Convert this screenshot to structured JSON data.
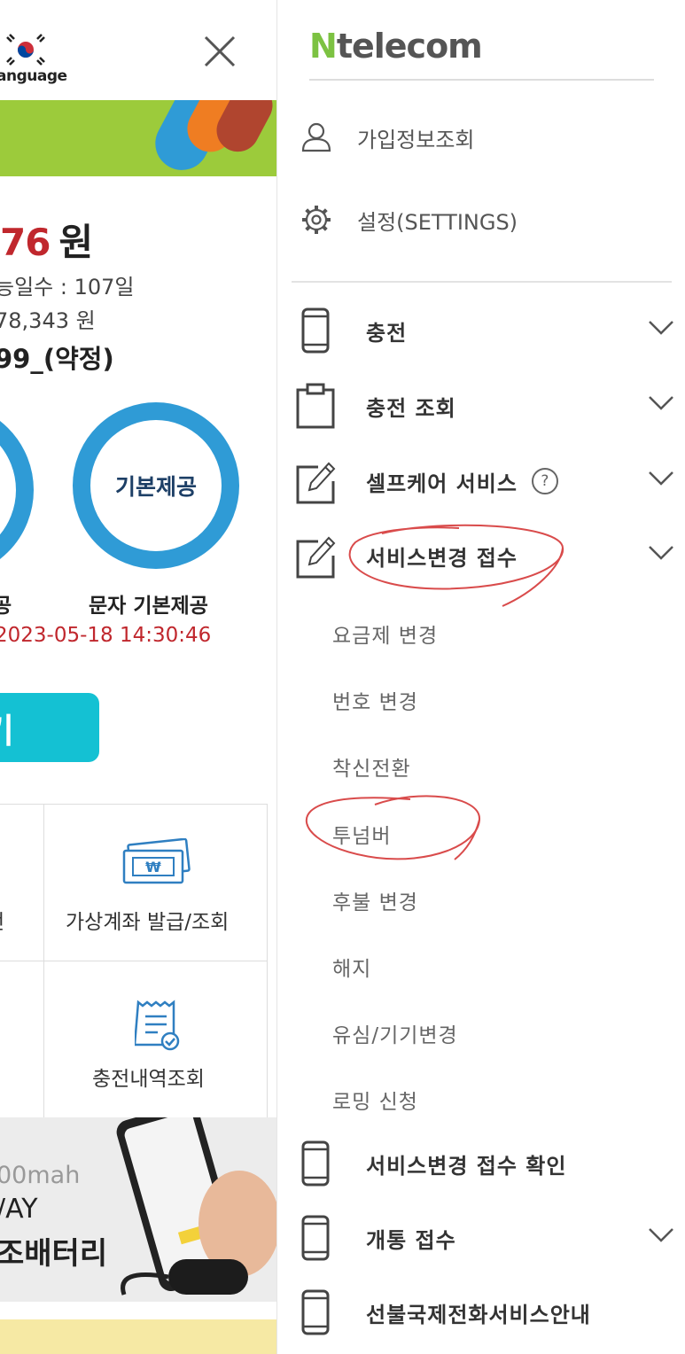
{
  "background_page": {
    "language_label": "anguage",
    "balance_amount": "76",
    "balance_unit": "원",
    "remaining_days": "능일수 : 107일",
    "usage_amount": "78,343 원",
    "plan_name": "99_(약정)",
    "ring_right_text": "기본제공",
    "label_left": "공",
    "label_right": "문자 기본제공",
    "updated_at": "2023-05-18 14:30:46",
    "charge_button_label": "기",
    "grid": {
      "virtual_account": "가상계좌 발급/조회",
      "left_cut_1": "전",
      "charge_history": "충전내역조회"
    },
    "ad": {
      "line1": "00mah",
      "line2": "/AY",
      "line3": "조배터리"
    },
    "colors": {
      "accent_red": "#c0272d",
      "ring_blue": "#2f9bd6",
      "button_teal": "#14c1d3",
      "banner_green": "#9ccb3b"
    }
  },
  "drawer": {
    "brand_n": "N",
    "brand_rest": "telecom",
    "brand_color": "#7cc242",
    "top_items": [
      {
        "label": "가입정보조회",
        "icon": "user-icon"
      },
      {
        "label": "설정(SETTINGS)",
        "icon": "gear-icon"
      }
    ],
    "menu": [
      {
        "label": "충전",
        "icon": "phone-icon",
        "expandable": true
      },
      {
        "label": "충전 조회",
        "icon": "clipboard-icon",
        "expandable": true
      },
      {
        "label": "셀프케어 서비스",
        "icon": "edit-icon",
        "expandable": true,
        "help": "?"
      },
      {
        "label": "서비스변경 접수",
        "icon": "edit-icon",
        "expandable": true,
        "expanded": true
      },
      {
        "label": "서비스변경 접수 확인",
        "icon": "phone-icon",
        "expandable": false
      },
      {
        "label": "개통 접수",
        "icon": "phone-icon",
        "expandable": true
      },
      {
        "label": "선불국제전화서비스안내",
        "icon": "phone-icon",
        "expandable": false
      }
    ],
    "submenu": [
      "요금제 변경",
      "번호 변경",
      "착신전환",
      "투넘버",
      "후불 변경",
      "해지",
      "유심/기기변경",
      "로밍 신청"
    ]
  }
}
